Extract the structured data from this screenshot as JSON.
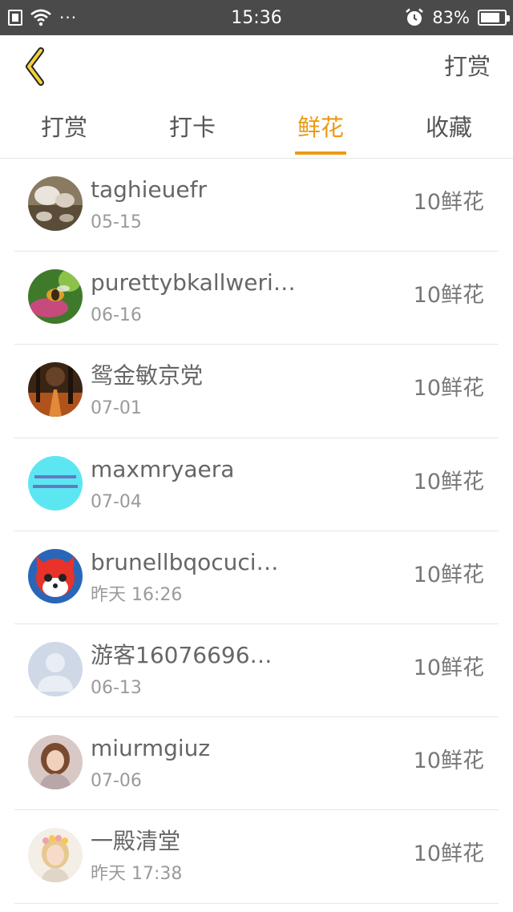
{
  "status_bar": {
    "time": "15:36",
    "battery_percent": "83%",
    "battery_level": 0.83,
    "icons": [
      "sim-icon",
      "wifi-icon",
      "more-dots-icon",
      "alarm-icon",
      "battery-icon"
    ],
    "dots": "···"
  },
  "header": {
    "back_icon": "chevron-left-icon",
    "action_label": "打赏",
    "accent_color": "#ec9a15"
  },
  "tabs": [
    {
      "label": "打赏",
      "active": false
    },
    {
      "label": "打卡",
      "active": false
    },
    {
      "label": "鲜花",
      "active": true
    },
    {
      "label": "收藏",
      "active": false
    }
  ],
  "list": {
    "items": [
      {
        "name": "taghieuefr",
        "date": "05-15",
        "amount": "10鲜花",
        "avatar": "photo-dog-and-cat"
      },
      {
        "name": "purettybkallweri…",
        "date": "06-16",
        "amount": "10鲜花",
        "avatar": "photo-bee-on-flower"
      },
      {
        "name": "鸳金敏京党",
        "date": "07-01",
        "amount": "10鲜花",
        "avatar": "photo-autumn-forest"
      },
      {
        "name": "maxmryaera",
        "date": "07-04",
        "amount": "10鲜花",
        "avatar": "cyan-text-image"
      },
      {
        "name": "brunellbqocuci…",
        "date": "昨天 16:26",
        "amount": "10鲜花",
        "avatar": "cartoon-red-fox"
      },
      {
        "name": "游客16076696…",
        "date": "06-13",
        "amount": "10鲜花",
        "avatar": "default-user-silhouette"
      },
      {
        "name": "miurmgiuz",
        "date": "07-06",
        "amount": "10鲜花",
        "avatar": "photo-girl-portrait"
      },
      {
        "name": "一殿清堂",
        "date": "昨天 17:38",
        "amount": "10鲜花",
        "avatar": "photo-child-flower-crown"
      }
    ]
  }
}
